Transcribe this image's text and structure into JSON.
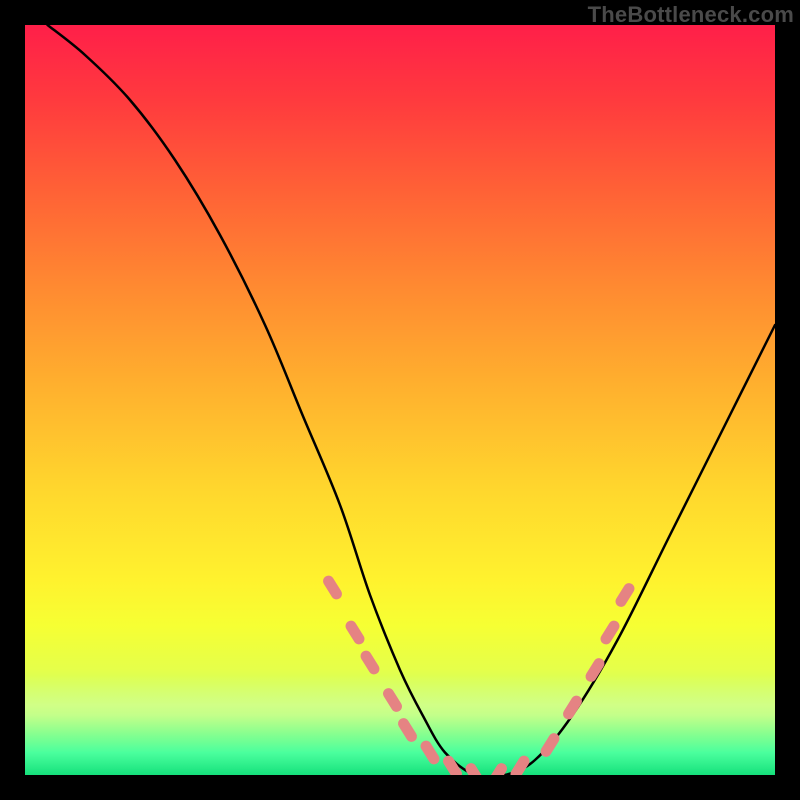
{
  "watermark": "TheBottleneck.com",
  "colors": {
    "curve_stroke": "#000000",
    "marker_fill": "#e58383",
    "background": "#000000"
  },
  "chart_data": {
    "type": "line",
    "title": "",
    "xlabel": "",
    "ylabel": "",
    "xlim": [
      0,
      100
    ],
    "ylim": [
      0,
      100
    ],
    "series": [
      {
        "name": "curve",
        "x": [
          3,
          8,
          14,
          20,
          26,
          32,
          37,
          42,
          46,
          50,
          53,
          56,
          60,
          64,
          68,
          73,
          79,
          86,
          94,
          100
        ],
        "y": [
          100,
          96,
          90,
          82,
          72,
          60,
          48,
          36,
          24,
          14,
          8,
          3,
          0,
          0,
          2,
          8,
          18,
          32,
          48,
          60
        ]
      }
    ],
    "markers": [
      {
        "x": 41,
        "y": 25
      },
      {
        "x": 44,
        "y": 19
      },
      {
        "x": 46,
        "y": 15
      },
      {
        "x": 49,
        "y": 10
      },
      {
        "x": 51,
        "y": 6
      },
      {
        "x": 54,
        "y": 3
      },
      {
        "x": 57,
        "y": 1
      },
      {
        "x": 60,
        "y": 0
      },
      {
        "x": 63,
        "y": 0
      },
      {
        "x": 66,
        "y": 1
      },
      {
        "x": 70,
        "y": 4
      },
      {
        "x": 73,
        "y": 9
      },
      {
        "x": 76,
        "y": 14
      },
      {
        "x": 78,
        "y": 19
      },
      {
        "x": 80,
        "y": 24
      }
    ],
    "gradient_stops": [
      {
        "pos": 0.0,
        "color": "#ff1f49"
      },
      {
        "pos": 0.1,
        "color": "#ff3a3e"
      },
      {
        "pos": 0.22,
        "color": "#ff6136"
      },
      {
        "pos": 0.35,
        "color": "#ff8a31"
      },
      {
        "pos": 0.48,
        "color": "#ffb02e"
      },
      {
        "pos": 0.62,
        "color": "#ffd72d"
      },
      {
        "pos": 0.74,
        "color": "#fff22e"
      },
      {
        "pos": 0.8,
        "color": "#f6ff33"
      },
      {
        "pos": 0.86,
        "color": "#e5ff4a"
      },
      {
        "pos": 0.92,
        "color": "#b7ff7b"
      },
      {
        "pos": 0.97,
        "color": "#3fff9d"
      },
      {
        "pos": 1.0,
        "color": "#15e07b"
      }
    ]
  }
}
